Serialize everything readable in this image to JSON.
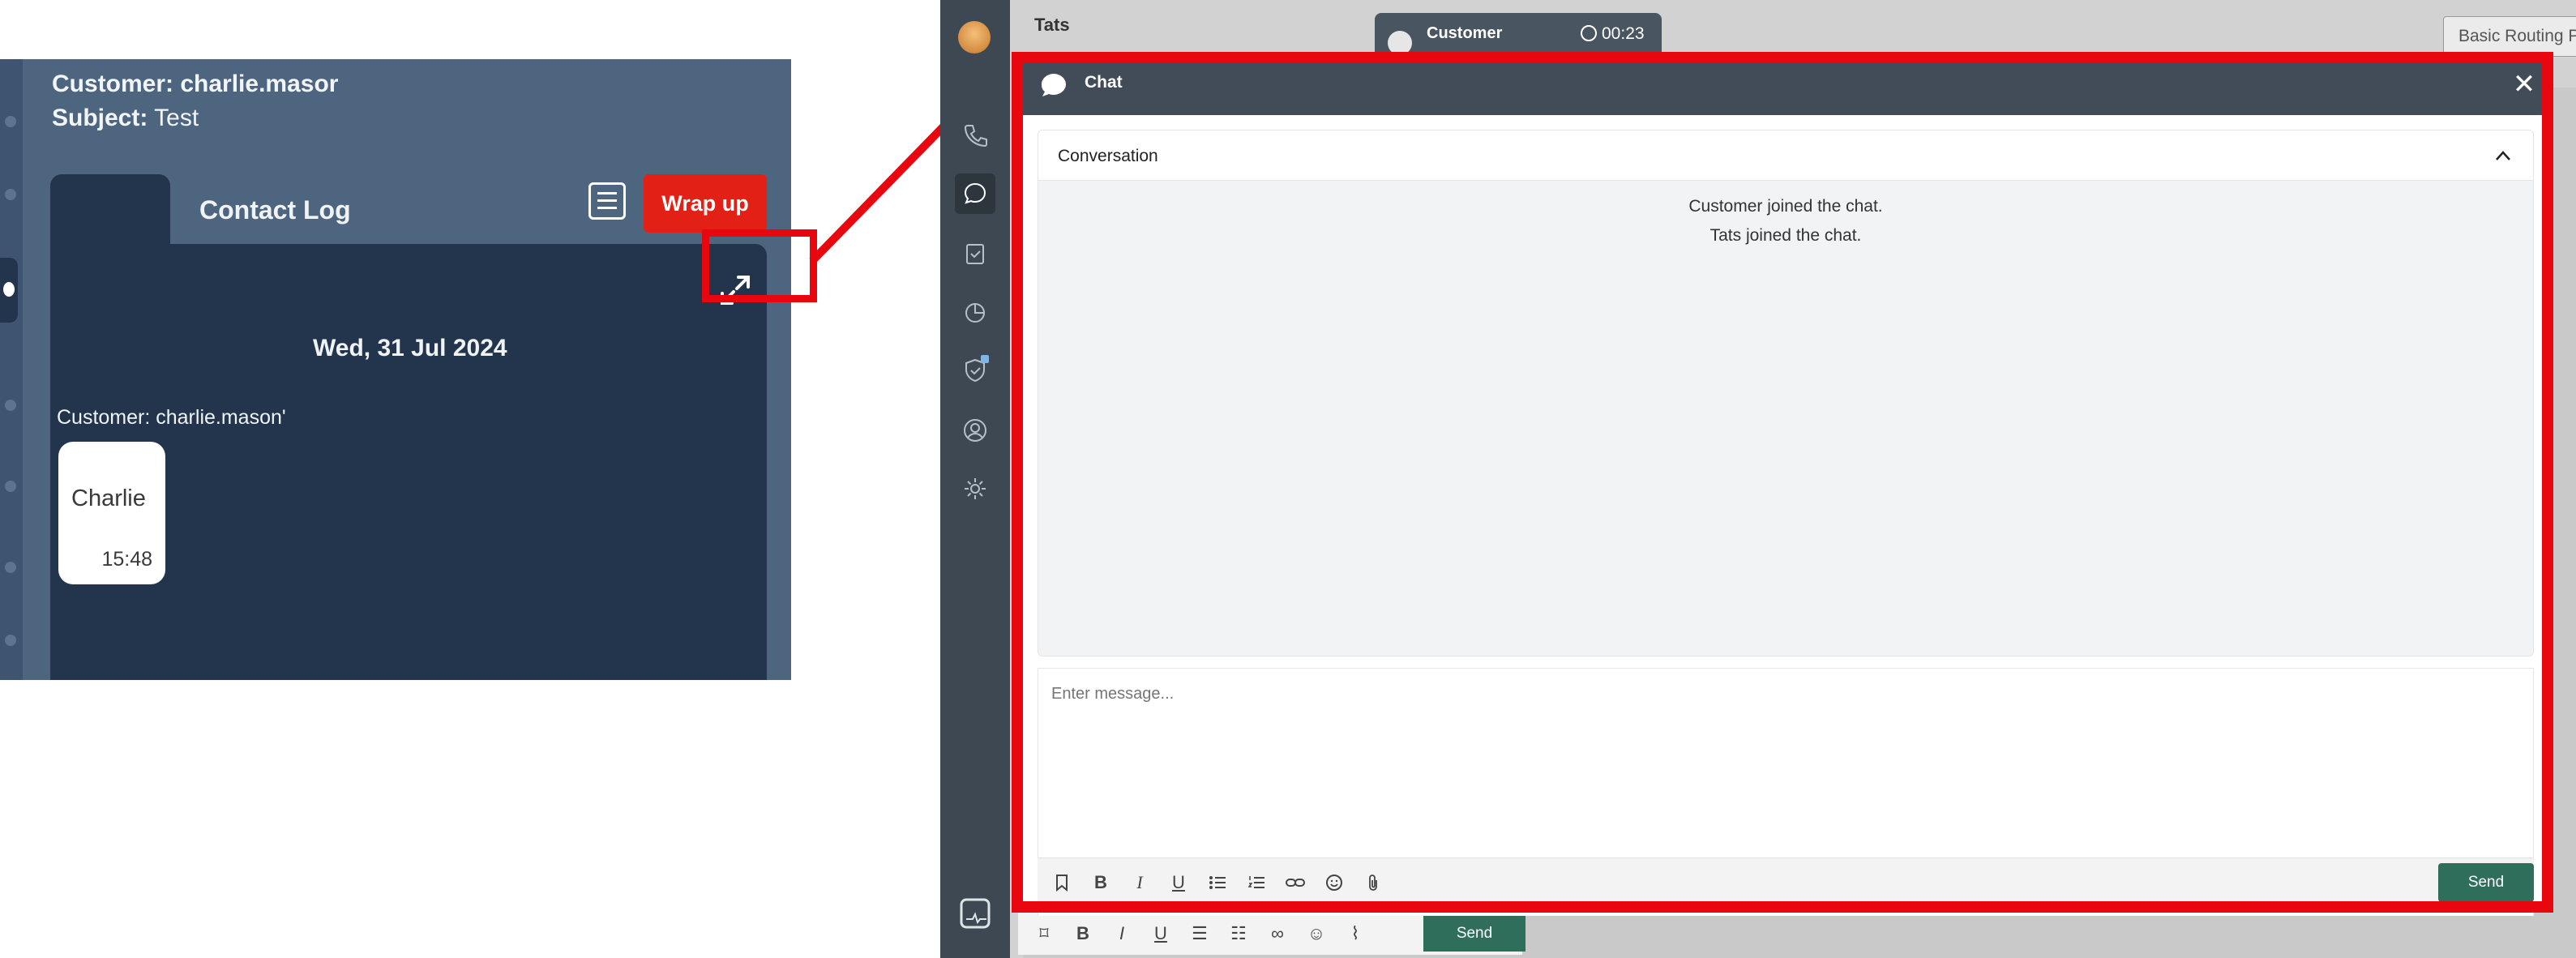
{
  "zoom_callout": {
    "customer_label": "Customer: charlie.masor",
    "subject_key": "Subject:",
    "subject_value": "Test",
    "tab_contact_log": "Contact Log",
    "wrap_up": "Wrap up",
    "date": "Wed, 31 Jul 2024",
    "message_author": "Customer: charlie.mason'",
    "bubble_text": "Charlie",
    "bubble_time": "15:48"
  },
  "background": {
    "agent_name": "Tats",
    "customer_card_name": "Customer",
    "customer_card_timer": "00:23",
    "routing": "Basic Routing P",
    "send_label": "Send"
  },
  "chat_modal": {
    "title": "Chat",
    "close_glyph": "✕",
    "conversation_label": "Conversation",
    "system_messages": [
      "Customer joined the chat.",
      "Tats joined the chat."
    ],
    "input_placeholder": "Enter message...",
    "send_label": "Send",
    "toolbar_icons": [
      "bookmark-icon",
      "bold-icon",
      "italic-icon",
      "underline-icon",
      "bullet-list-icon",
      "numbered-list-icon",
      "link-icon",
      "emoji-icon",
      "attachment-icon"
    ]
  },
  "colors": {
    "highlight": "#e8060f",
    "modal_header": "#424c58",
    "send_button": "#2e6e5a",
    "rail": "#3e4852",
    "wrap_up": "#e32016"
  }
}
